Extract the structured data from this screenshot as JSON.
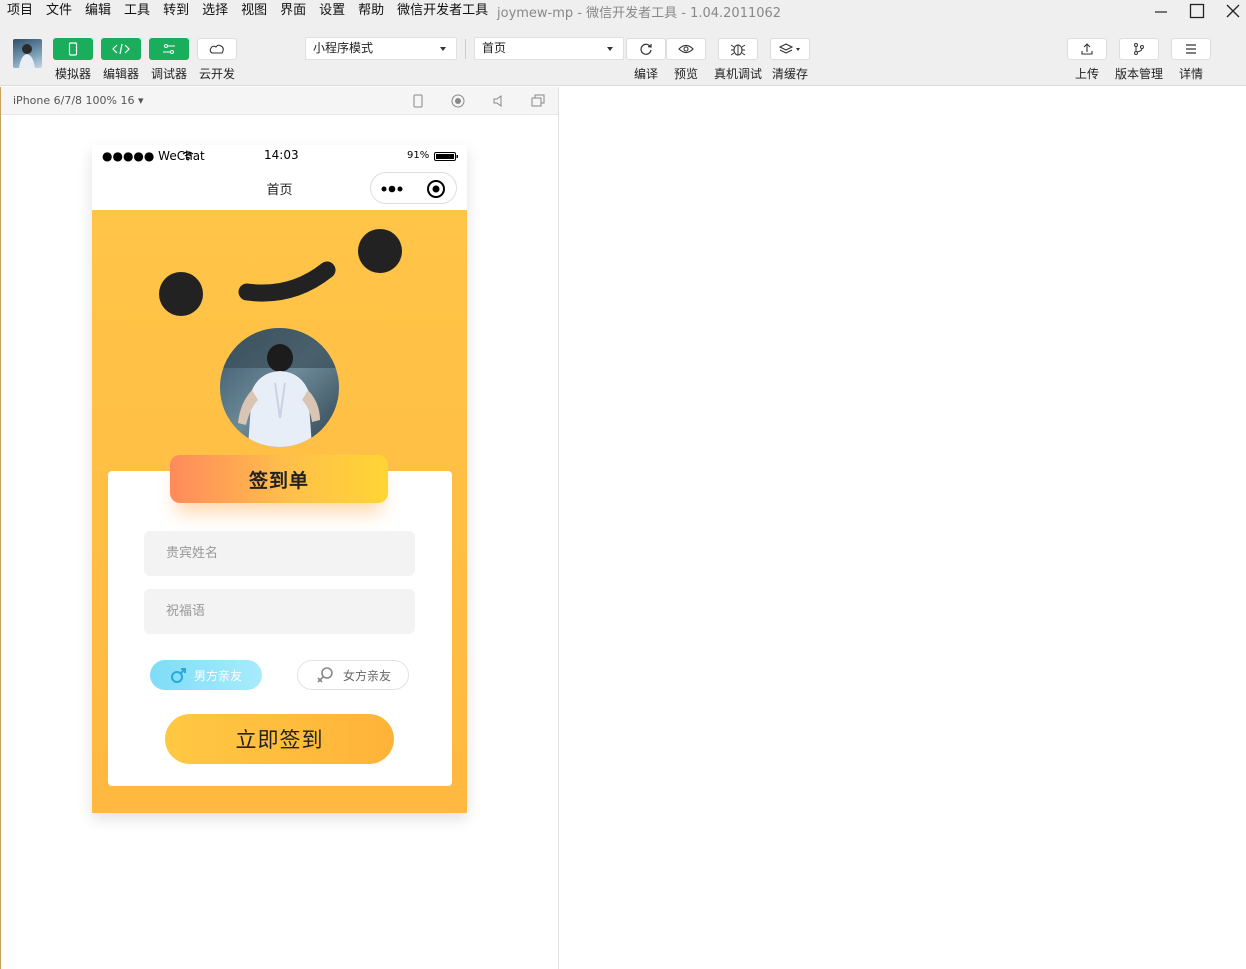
{
  "menu": [
    "项目",
    "文件",
    "编辑",
    "工具",
    "转到",
    "选择",
    "视图",
    "界面",
    "设置",
    "帮助",
    "微信开发者工具"
  ],
  "window": {
    "title": "joymew-mp - 微信开发者工具 - 1.04.2011062"
  },
  "toolbar": {
    "left": [
      {
        "label": "模拟器",
        "icon": "phone-icon",
        "style": "green"
      },
      {
        "label": "编辑器",
        "icon": "code-icon",
        "style": "green"
      },
      {
        "label": "调试器",
        "icon": "debug-icon",
        "style": "green"
      },
      {
        "label": "云开发",
        "icon": "cloud-icon",
        "style": "white"
      }
    ],
    "mode_select": "小程序模式",
    "page_select": "首页",
    "center": [
      {
        "label": "编译",
        "icon": "refresh-icon"
      },
      {
        "label": "预览",
        "icon": "eye-icon"
      },
      {
        "label": "真机调试",
        "icon": "bug-icon"
      },
      {
        "label": "清缓存",
        "icon": "layers-icon"
      }
    ],
    "right": [
      {
        "label": "上传",
        "icon": "upload-icon"
      },
      {
        "label": "版本管理",
        "icon": "branch-icon"
      },
      {
        "label": "详情",
        "icon": "menu-icon"
      }
    ]
  },
  "simulator": {
    "device_label": "iPhone 6/7/8 100% 16 ▾"
  },
  "phone": {
    "status": {
      "carrier": "●●●●● WeChat",
      "time": "14:03",
      "battery": "91%"
    },
    "nav_title": "首页",
    "banner_title": "签到单",
    "name_placeholder": "贵宾姓名",
    "wish_placeholder": "祝福语",
    "male_label": "男方亲友",
    "female_label": "女方亲友",
    "submit_label": "立即签到"
  },
  "colors": {
    "accent_green": "#1aad5b",
    "bg_yellow": "#ffc548",
    "male_blue": "#8fe0f5"
  }
}
